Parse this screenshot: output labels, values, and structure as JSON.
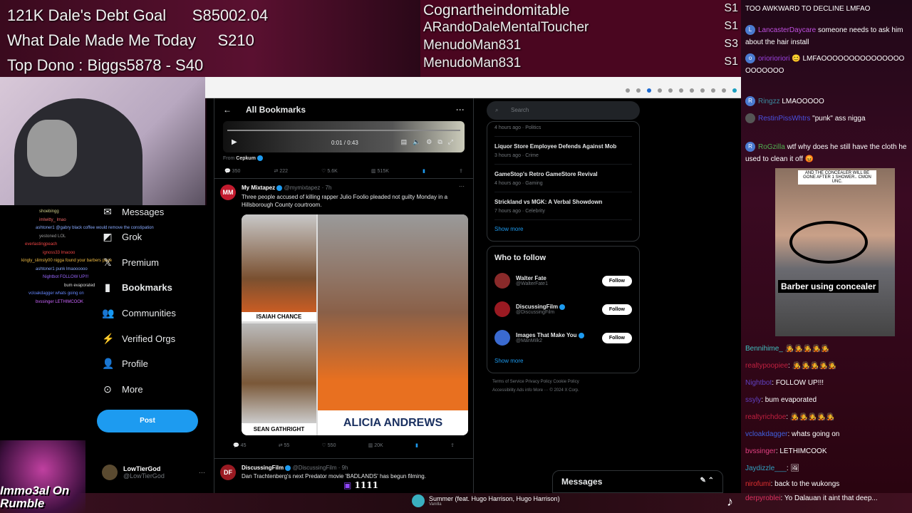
{
  "overlay": {
    "goal_line": "121K Dale's Debt Goal      S85002.04",
    "today_line": "What Dale Made Me Today     S210",
    "top_dono": "Top Dono : Biggs5878 - S40"
  },
  "donors": [
    {
      "name": "Cognartheindomitable",
      "amount": "S1"
    },
    {
      "name": "ARandoDaleMentalToucher",
      "amount": "S1"
    },
    {
      "name": "MenudoMan831",
      "amount": "S3"
    },
    {
      "name": "MenudoMan831",
      "amount": "S1"
    }
  ],
  "nav": [
    {
      "icon": "mail-icon",
      "glyph": "✉",
      "label": "Messages"
    },
    {
      "icon": "grok-icon",
      "glyph": "◩",
      "label": "Grok"
    },
    {
      "icon": "x-icon",
      "glyph": "𝕏",
      "label": "Premium"
    },
    {
      "icon": "bookmark-icon",
      "glyph": "▮",
      "label": "Bookmarks"
    },
    {
      "icon": "communities-icon",
      "glyph": "👥",
      "label": "Communities"
    },
    {
      "icon": "verified-orgs-icon",
      "glyph": "⚡",
      "label": "Verified Orgs"
    },
    {
      "icon": "profile-icon",
      "glyph": "👤",
      "label": "Profile"
    },
    {
      "icon": "more-icon",
      "glyph": "⊙",
      "label": "More"
    }
  ],
  "post_label": "Post",
  "profile": {
    "name": "LowTierGod",
    "handle": "@LowTierGod"
  },
  "overlay_chat": [
    "shoebingg",
    "imlwitty_ lmao",
    "ashtoner1 @gabry black coffee would remove the constipation",
    "yestoned LOL",
    "everlastingpeach",
    "ignoss33 lmaooo",
    "kingly_slimsty00 nigga found your barbers page",
    "ashtoner1 punk lmaoooooo",
    "Nightbot FOLLOW UP!!!",
    "bum evaporated",
    "vcloakdagger whats going on",
    "bvssinger LETHIMCOOK"
  ],
  "feed": {
    "title": "All Bookmarks",
    "video_time": "0:01 / 0:43",
    "from_label": "From",
    "from_name": "Cepkum",
    "tweet1_actions": [
      "350",
      "222",
      "5.6K",
      "515K"
    ],
    "tweet2": {
      "name": "My Mixtapez",
      "handle": "@mymixtapez · 7h",
      "text": "Three people accused of killing rapper Julio Foolio pleaded not guilty Monday in a Hillsborough County courtroom.",
      "caption1": "ISAIAH CHANCE",
      "caption2": "SEAN GATHRIGHT",
      "caption3": "ALICIA ANDREWS",
      "actions": [
        "45",
        "55",
        "550",
        "20K"
      ]
    },
    "tweet3": {
      "name": "DiscussingFilm",
      "handle": "@DiscussingFilm · 9h",
      "text": "Dan Trachtenberg's next Predator movie 'BADLANDS' has begun filming."
    }
  },
  "right": {
    "search_placeholder": "Search",
    "trends": [
      {
        "title": "",
        "meta": "4 hours ago · Politics"
      },
      {
        "title": "Liquor Store Employee Defends Against Mob",
        "meta": "3 hours ago · Crime"
      },
      {
        "title": "GameStop's Retro GameStore Revival",
        "meta": "4 hours ago · Gaming"
      },
      {
        "title": "Strickland vs MGK: A Verbal Showdown",
        "meta": "7 hours ago · Celebrity"
      }
    ],
    "show_more": "Show more",
    "who_to_follow": "Who to follow",
    "follow": [
      {
        "name": "Walter Fate",
        "handle": "@WalterFate1",
        "color": "#8a2a2a"
      },
      {
        "name": "DiscussingFilm",
        "handle": "@DiscussingFilm",
        "color": "#9a1a22"
      },
      {
        "name": "Images That Make You",
        "handle": "@ManMilk2",
        "color": "#3a6ad0"
      }
    ],
    "follow_label": "Follow",
    "footer1": "Terms of Service   Privacy Policy   Cookie Policy",
    "footer2": "Accessibility   Ads info   More ···   © 2024 X Corp."
  },
  "messages_label": "Messages",
  "viewer_count": "1111",
  "chat": [
    {
      "user": "",
      "text": "TOO AWKWARD TO DECLINE LMFAO",
      "color": "#a070ff"
    },
    {
      "user": "LancasterDaycare",
      "text": "someone needs to ask him about the hair install",
      "color": "#c050e0"
    },
    {
      "user": "oriorioriori",
      "text": "😊 LMFAOOOOOOOOOOOOOOOOOOOOOO",
      "color": "#9a40e0"
    },
    {
      "user": "Ringzz",
      "text": "LMAOOOOO",
      "color": "#3a8aa0"
    },
    {
      "user": "RestinPissWhtrs",
      "text": "\"punk\" ass nigga",
      "color": "#4a50e0"
    },
    {
      "user": "RoGzilla",
      "text": "wtf why does he still have the cloth he used to clean it off 😡",
      "color": "#50b050"
    }
  ],
  "clip": {
    "caption_top": "AND THE CONCEALER WILL BE GONE AFTER 1 SHOWER.. CMON UNC.",
    "caption": "Barber using concealer"
  },
  "chat2": [
    {
      "user": "Bennihime_",
      "text": "",
      "color": "#40c0c0"
    },
    {
      "user": "realtypoopiee",
      "text": "",
      "color": "#c02040"
    },
    {
      "user": "Nightbot",
      "text": "FOLLOW UP!!!",
      "color": "#6040c0"
    },
    {
      "user": "ssyly",
      "text": "bum evaporated",
      "color": "#6040c0"
    },
    {
      "user": "realtyrichdoe",
      "text": "",
      "color": "#c02040"
    },
    {
      "user": "vcloakdagger",
      "text": "whats going on",
      "color": "#4060e0"
    },
    {
      "user": "bvssinger",
      "text": "LETHIMCOOK",
      "color": "#e04080"
    },
    {
      "user": "Jaydizzle___",
      "text": "",
      "color": "#30a0c0"
    },
    {
      "user": "nirofumi",
      "text": "back to the wukongs",
      "color": "#e03030"
    },
    {
      "user": "derpyroblei",
      "text": "Yo Dalauan it aint that deep...",
      "color": "#e03060"
    }
  ],
  "now_playing": {
    "title": "Summer (feat. Hugo Harrison, Hugo Harrison)",
    "artist": "Vanilla"
  },
  "logo_text": "Immo3al On Rumble"
}
